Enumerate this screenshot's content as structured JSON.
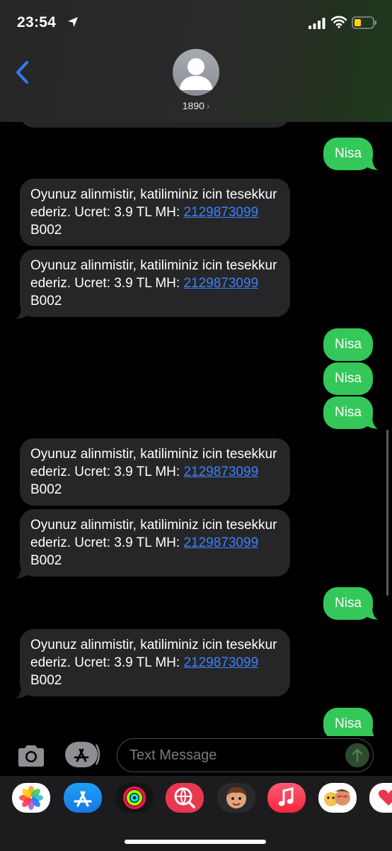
{
  "status_bar": {
    "time": "23:54"
  },
  "header": {
    "contact": "1890"
  },
  "messages": [
    {
      "dir": "out",
      "text": "Nisa"
    },
    {
      "dir": "in",
      "text": "Oyunuz alinmistir, katiliminiz icin tesekkur ederiz. Ucret: 3.9 TL MH:",
      "link": "2129873099",
      "suffix": " B002"
    },
    {
      "dir": "in",
      "text": "Oyunuz alinmistir, katiliminiz icin tesekkur ederiz. Ucret: 3.9 TL MH:",
      "link": "2129873099",
      "suffix": " B002"
    },
    {
      "dir": "out",
      "text": "Nisa"
    },
    {
      "dir": "out",
      "text": "Nisa"
    },
    {
      "dir": "out",
      "text": "Nisa"
    },
    {
      "dir": "in",
      "text": "Oyunuz alinmistir, katiliminiz icin tesekkur ederiz. Ucret: 3.9 TL MH:",
      "link": "2129873099",
      "suffix": " B002"
    },
    {
      "dir": "in",
      "text": "Oyunuz alinmistir, katiliminiz icin tesekkur ederiz. Ucret: 3.9 TL MH:",
      "link": "2129873099",
      "suffix": " B002"
    },
    {
      "dir": "out",
      "text": "Nisa"
    },
    {
      "dir": "in",
      "text": "Oyunuz alinmistir, katiliminiz icin tesekkur ederiz. Ucret: 3.9 TL MH:",
      "link": "2129873099",
      "suffix": " B002"
    },
    {
      "dir": "out",
      "text": "Nisa"
    }
  ],
  "input": {
    "placeholder": "Text Message"
  },
  "colors": {
    "outgoing": "#34c759",
    "incoming": "#262628",
    "link": "#3b82f6"
  },
  "drawer_apps": [
    {
      "name": "photos-app-icon"
    },
    {
      "name": "app-store-icon"
    },
    {
      "name": "activity-icon"
    },
    {
      "name": "images-search-icon"
    },
    {
      "name": "memoji-icon"
    },
    {
      "name": "music-icon"
    },
    {
      "name": "memoji-stickers-icon"
    },
    {
      "name": "digital-touch-icon"
    }
  ]
}
